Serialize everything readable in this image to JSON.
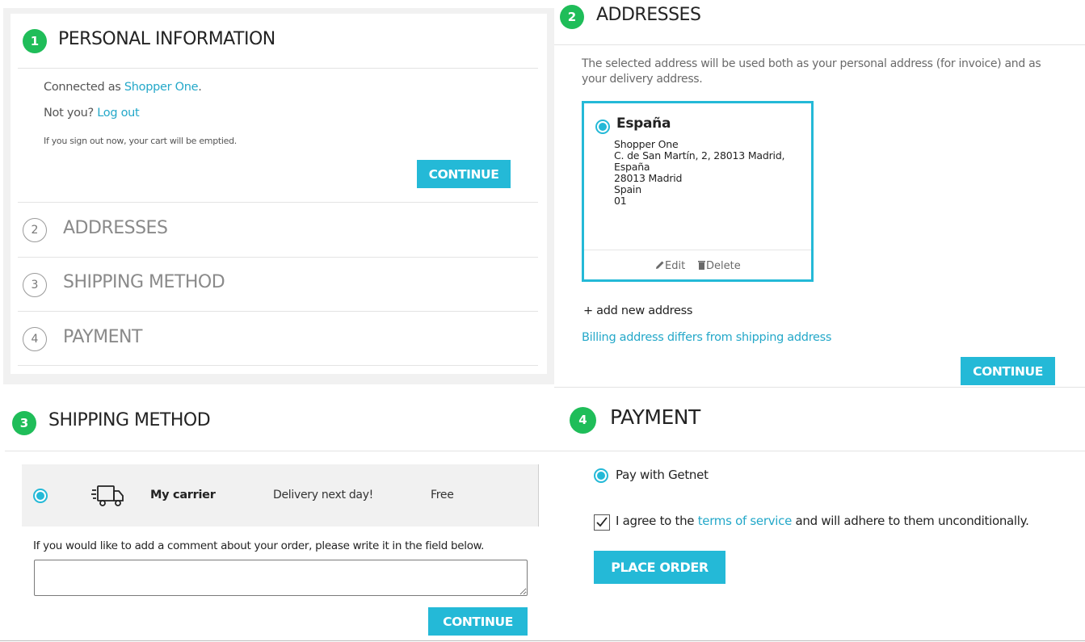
{
  "personal": {
    "step": "1",
    "title": "PERSONAL INFORMATION",
    "connected_prefix": "Connected as ",
    "connected_user": "Shopper One",
    "connected_suffix": ".",
    "not_you": "Not you? ",
    "logout": "Log out",
    "signout_note": "If you sign out now, your cart will be emptied.",
    "continue": "CONTINUE",
    "collapsed_steps": [
      {
        "num": "2",
        "label": "ADDRESSES"
      },
      {
        "num": "3",
        "label": "SHIPPING METHOD"
      },
      {
        "num": "4",
        "label": "PAYMENT"
      }
    ]
  },
  "addresses": {
    "step": "2",
    "title": "ADDRESSES",
    "intro_line1": "The selected address will be used both as your personal address (for invoice) and as",
    "intro_line2": "your delivery address.",
    "card": {
      "alias": "España",
      "lines": [
        "Shopper One",
        "C. de San Martín, 2, 28013 Madrid,",
        "España",
        "28013 Madrid",
        "Spain",
        "01"
      ],
      "edit": "Edit",
      "delete": "Delete"
    },
    "add_new": "+ add new address",
    "billing_differs": "Billing address differs from shipping address",
    "continue": "CONTINUE"
  },
  "shipping": {
    "step": "3",
    "title": "SHIPPING METHOD",
    "carrier_name": "My carrier",
    "carrier_delay": "Delivery next day!",
    "carrier_price": "Free",
    "comment_label": "If you would like to add a comment about your order, please write it in the field below.",
    "comment_value": "",
    "continue": "CONTINUE"
  },
  "payment": {
    "step": "4",
    "title": "PAYMENT",
    "option_label": "Pay with Getnet",
    "agree_prefix": "I agree to the ",
    "agree_link": "terms of service",
    "agree_suffix": " and will adhere to them unconditionally.",
    "place_order": "PLACE ORDER"
  },
  "colors": {
    "accent": "#24b9d7",
    "step_green": "#1fbd59",
    "link": "#24a8c9"
  }
}
